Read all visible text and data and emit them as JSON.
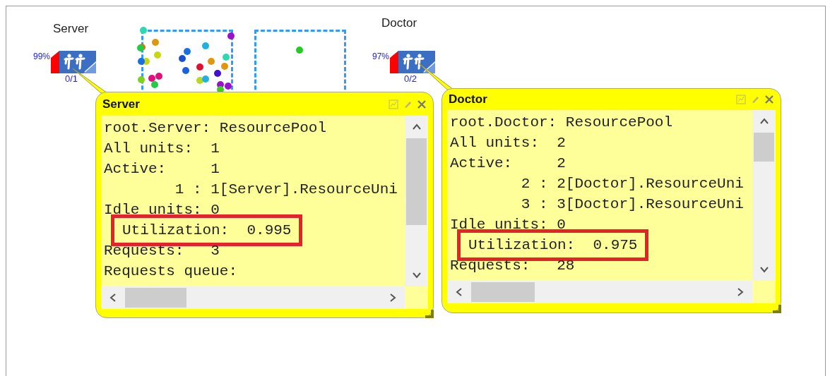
{
  "canvas": {
    "resource_pools": [
      {
        "name": "Server",
        "utilization": "99%",
        "units": "0/1"
      },
      {
        "name": "Doctor",
        "utilization": "97%",
        "units": "0/2"
      }
    ],
    "inspect_windows": [
      {
        "title": "Server",
        "lines": [
          {
            "kind": "plain",
            "text": "root.Server: ResourcePool"
          },
          {
            "kind": "plain",
            "text": "All units:  1"
          },
          {
            "kind": "plain",
            "text": "Active:     1"
          },
          {
            "kind": "unit",
            "text": "1 : 1[Server].ResourceUni"
          },
          {
            "kind": "plain",
            "text": "Idle units: 0"
          },
          {
            "kind": "highlight",
            "text": "Utilization:  0.995"
          },
          {
            "kind": "plain",
            "text": "Requests:   3"
          },
          {
            "kind": "plain",
            "text": "Requests queue:"
          }
        ]
      },
      {
        "title": "Doctor",
        "lines": [
          {
            "kind": "plain",
            "text": "root.Doctor: ResourcePool"
          },
          {
            "kind": "plain",
            "text": "All units:  2"
          },
          {
            "kind": "plain",
            "text": "Active:     2"
          },
          {
            "kind": "unit",
            "text": "2 : 2[Doctor].ResourceUni"
          },
          {
            "kind": "unit",
            "text": "3 : 3[Doctor].ResourceUni"
          },
          {
            "kind": "plain",
            "text": "Idle units: 0"
          },
          {
            "kind": "highlight",
            "text": "Utilization:  0.975"
          },
          {
            "kind": "plain",
            "text": "Requests:   28"
          }
        ]
      }
    ]
  }
}
